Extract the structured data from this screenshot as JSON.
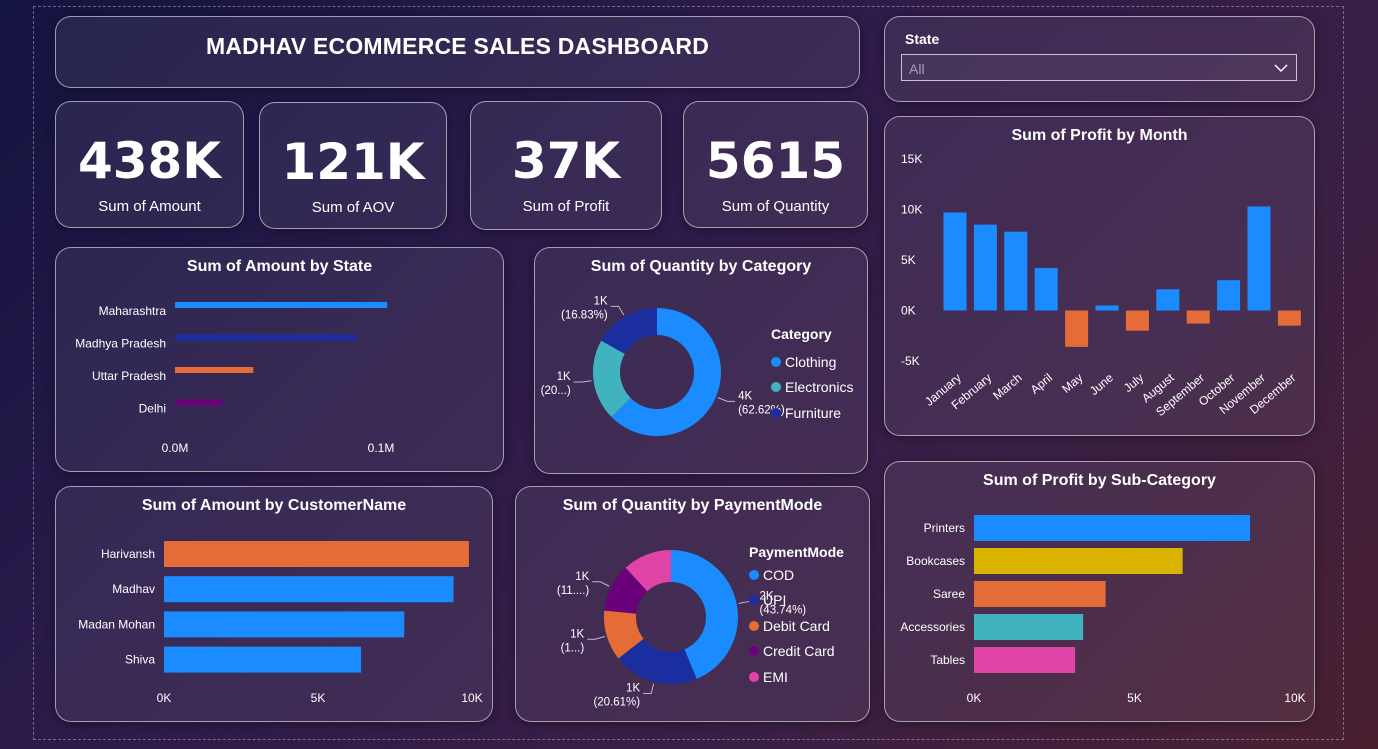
{
  "dashboard": {
    "title": "MADHAV ECOMMERCE SALES DASHBOARD"
  },
  "kpis": [
    {
      "value": "438K",
      "label": "Sum of Amount"
    },
    {
      "value": "121K",
      "label": "Sum of AOV"
    },
    {
      "value": "37K",
      "label": "Sum of Profit"
    },
    {
      "value": "5615",
      "label": "Sum of Quantity"
    }
  ],
  "slicer": {
    "label": "State",
    "value": "All"
  },
  "colors": {
    "blue": "#1a8cff",
    "navy": "#1a2ea0",
    "orange": "#e66c37",
    "purple": "#6b007b",
    "teal": "#41b3bf",
    "yellow": "#d9b300",
    "pink": "#e044a7"
  },
  "chart_data": [
    {
      "id": "amount_by_state",
      "type": "bar",
      "orientation": "horizontal",
      "title": "Sum of Amount by State",
      "categories": [
        "Maharashtra",
        "Madhya Pradesh",
        "Uttar Pradesh",
        "Delhi"
      ],
      "values": [
        0.103,
        0.088,
        0.038,
        0.023
      ],
      "xlim": [
        0,
        0.15
      ],
      "ticks": [
        0,
        0.1
      ],
      "tick_labels": [
        "0.0M",
        "0.1M"
      ],
      "bar_colors": [
        "#1a8cff",
        "#1a2ea0",
        "#e66c37",
        "#6b007b"
      ]
    },
    {
      "id": "quantity_by_category",
      "type": "pie",
      "donut": true,
      "title": "Sum of Quantity by Category",
      "legend_title": "Category",
      "labels": [
        "Clothing",
        "Electronics",
        "Furniture"
      ],
      "values": [
        62.62,
        20.55,
        16.83
      ],
      "slice_labels": [
        "4K\n(62.62%)",
        "1K\n(20...)",
        "1K\n(16.83%)"
      ],
      "colors": [
        "#1a8cff",
        "#41b3bf",
        "#1a2ea0"
      ]
    },
    {
      "id": "profit_by_month",
      "type": "bar",
      "title": "Sum of Profit by Month",
      "categories": [
        "January",
        "February",
        "March",
        "April",
        "May",
        "June",
        "July",
        "August",
        "September",
        "October",
        "November",
        "December"
      ],
      "values": [
        9700,
        8500,
        7800,
        4200,
        -3600,
        500,
        -2000,
        2100,
        -1300,
        3000,
        10300,
        -1500
      ],
      "ylim": [
        -5000,
        15000
      ],
      "ticks": [
        -5000,
        0,
        5000,
        10000,
        15000
      ],
      "tick_labels": [
        "-5K",
        "0K",
        "5K",
        "10K",
        "15K"
      ],
      "positive_color": "#1a8cff",
      "negative_color": "#e66c37"
    },
    {
      "id": "amount_by_customer",
      "type": "bar",
      "orientation": "horizontal",
      "title": "Sum of Amount by CustomerName",
      "categories": [
        "Harivansh",
        "Madhav",
        "Madan Mohan",
        "Shiva"
      ],
      "values": [
        9900,
        9400,
        7800,
        6400
      ],
      "xlim": [
        0,
        10000
      ],
      "ticks": [
        0,
        5000,
        10000
      ],
      "tick_labels": [
        "0K",
        "5K",
        "10K"
      ],
      "bar_colors": [
        "#e66c37",
        "#1a8cff",
        "#1a8cff",
        "#1a8cff"
      ]
    },
    {
      "id": "quantity_by_paymentmode",
      "type": "pie",
      "donut": true,
      "title": "Sum of Quantity by PaymentMode",
      "legend_title": "PaymentMode",
      "labels": [
        "COD",
        "UPI",
        "Debit Card",
        "Credit Card",
        "EMI"
      ],
      "values": [
        43.74,
        20.61,
        12.2,
        11.6,
        11.85
      ],
      "slice_labels": [
        "2K\n(43.74%)",
        "1K\n(20.61%)",
        "1K\n(1...)",
        "1K\n(11....)",
        ""
      ],
      "colors": [
        "#1a8cff",
        "#1a2ea0",
        "#e66c37",
        "#6b007b",
        "#e044a7"
      ]
    },
    {
      "id": "profit_by_subcategory",
      "type": "bar",
      "orientation": "horizontal",
      "title": "Sum of Profit by Sub-Category",
      "categories": [
        "Printers",
        "Bookcases",
        "Saree",
        "Accessories",
        "Tables"
      ],
      "values": [
        8600,
        6500,
        4100,
        3400,
        3150
      ],
      "xlim": [
        0,
        10000
      ],
      "ticks": [
        0,
        5000,
        10000
      ],
      "tick_labels": [
        "0K",
        "5K",
        "10K"
      ],
      "bar_colors": [
        "#1a8cff",
        "#d9b300",
        "#e66c37",
        "#41b3bf",
        "#e044a7"
      ]
    }
  ]
}
